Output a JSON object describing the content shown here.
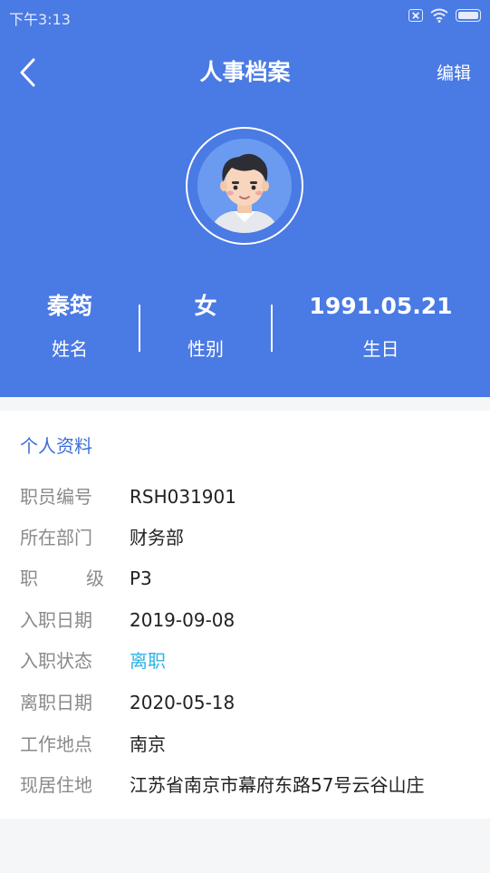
{
  "status_bar": {
    "time": "下午3:13"
  },
  "header": {
    "title": "人事档案",
    "edit_label": "编辑"
  },
  "profile": {
    "stats": [
      {
        "value": "秦筠",
        "label": "姓名"
      },
      {
        "value": "女",
        "label": "性别"
      },
      {
        "value": "1991.05.21",
        "label": "生日"
      }
    ]
  },
  "section": {
    "title": "个人资料",
    "rows": [
      {
        "label": "职员编号",
        "value": "RSH031901"
      },
      {
        "label": "所在部门",
        "value": "财务部"
      },
      {
        "label_chars": [
          "职",
          "级"
        ],
        "value": "P3"
      },
      {
        "label": "入职日期",
        "value": "2019-09-08"
      },
      {
        "label": "入职状态",
        "value": "离职"
      },
      {
        "label": "离职日期",
        "value": "2020-05-18"
      },
      {
        "label": "工作地点",
        "value": "南京"
      },
      {
        "label": "现居住地",
        "value": "江苏省南京市幕府东路57号云谷山庄"
      }
    ]
  },
  "colors": {
    "header_bg": "#4a7ae3",
    "accent": "#3a6fd8",
    "status_leave": "#2bb3e8"
  },
  "icons": [
    "back-arrow-icon",
    "sim-icon",
    "wifi-icon",
    "battery-icon",
    "avatar"
  ]
}
